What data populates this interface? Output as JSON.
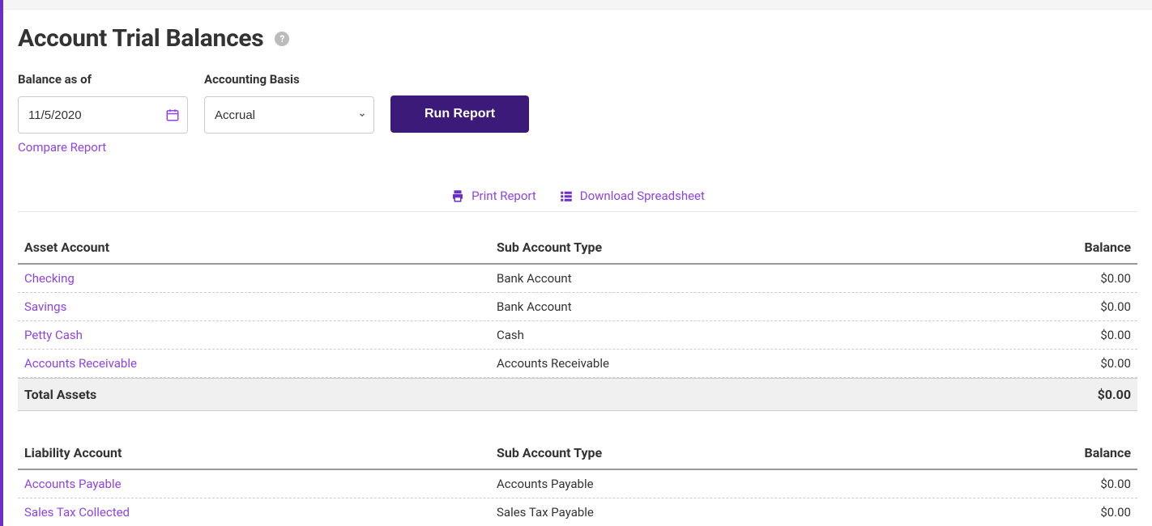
{
  "page": {
    "title": "Account Trial Balances"
  },
  "filters": {
    "balance_label": "Balance as of",
    "date_value": "11/5/2020",
    "basis_label": "Accounting Basis",
    "basis_value": "Accrual",
    "run_label": "Run Report",
    "compare_label": "Compare Report"
  },
  "actions": {
    "print": "Print Report",
    "download": "Download Spreadsheet"
  },
  "assets": {
    "header": {
      "account": "Asset Account",
      "sub": "Sub Account Type",
      "balance": "Balance"
    },
    "rows": [
      {
        "name": "Checking",
        "sub": "Bank Account",
        "balance": "$0.00"
      },
      {
        "name": "Savings",
        "sub": "Bank Account",
        "balance": "$0.00"
      },
      {
        "name": "Petty Cash",
        "sub": "Cash",
        "balance": "$0.00"
      },
      {
        "name": "Accounts Receivable",
        "sub": "Accounts Receivable",
        "balance": "$0.00"
      }
    ],
    "total_label": "Total Assets",
    "total_value": "$0.00"
  },
  "liabilities": {
    "header": {
      "account": "Liability Account",
      "sub": "Sub Account Type",
      "balance": "Balance"
    },
    "rows": [
      {
        "name": "Accounts Payable",
        "sub": "Accounts Payable",
        "balance": "$0.00"
      },
      {
        "name": "Sales Tax Collected",
        "sub": "Sales Tax Payable",
        "balance": "$0.00"
      }
    ]
  }
}
